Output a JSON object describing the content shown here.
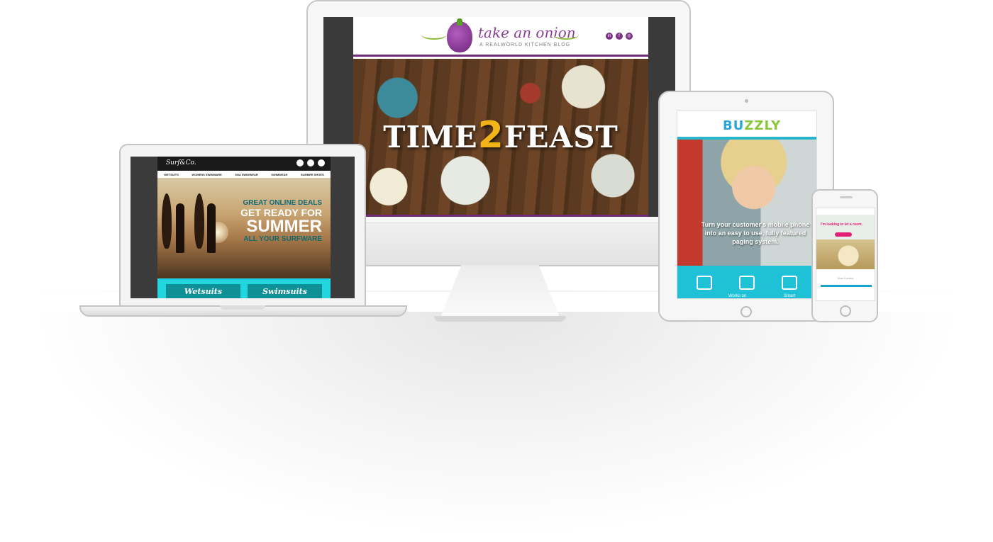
{
  "desktop_site": {
    "brand": "take an onion",
    "tagline": "A REALWORLD KITCHEN BLOG",
    "hero_word_left": "TIME",
    "hero_word_accent": "2",
    "hero_word_right": "FEAST",
    "social_icons": [
      "linkedin-icon",
      "facebook-icon",
      "instagram-icon"
    ],
    "colors": {
      "brand_purple": "#6f2a7a",
      "accent_gold": "#f2b419"
    }
  },
  "laptop_site": {
    "brand": "Surf&Co.",
    "nav": [
      "WETSUITS",
      "WOMENS SWIMWARE",
      "SNA SWIMWEAR",
      "SWIMWEAR",
      "SUMMER SHOES"
    ],
    "hero_line1": "GREAT ONLINE DEALS",
    "hero_line2": "GET READY FOR",
    "hero_line3": "SUMMER",
    "hero_line4": "ALL YOUR SURFWARE",
    "categories": [
      "Wetsuits",
      "Swimsuits"
    ],
    "colors": {
      "accent_cyan": "#22d6df",
      "accent_teal": "#0f8f96"
    }
  },
  "tablet_site": {
    "brand_part1": "BU",
    "brand_part2": "ZZLY",
    "hero_copy": "Turn your customer's mobile phone into an easy to use, fully featured paging system.",
    "strip_captions": [
      "Works on",
      "Smart"
    ],
    "colors": {
      "accent": "#1fc1d6"
    }
  },
  "phone_site": {
    "hero_title": "I'm looking to let a room.",
    "section_title": "How it works",
    "colors": {
      "accent": "#e21f75"
    }
  }
}
